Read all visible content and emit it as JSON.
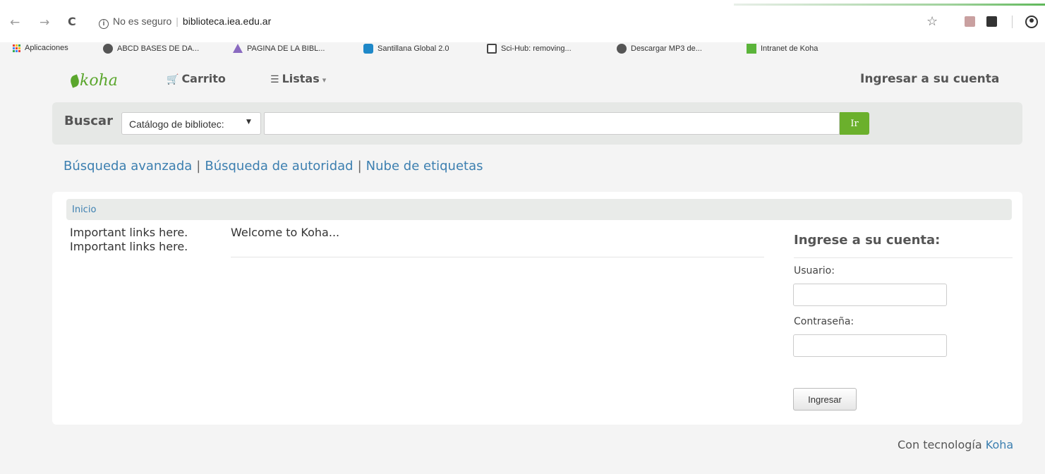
{
  "browser": {
    "security_label": "No es seguro",
    "url": "biblioteca.iea.edu.ar"
  },
  "bookmarks": [
    {
      "label": "Aplicaciones",
      "icon": "apps-grid-icon"
    },
    {
      "label": "ABCD BASES DE DA...",
      "icon": "globe-icon"
    },
    {
      "label": "PAGINA DE LA BIBL...",
      "icon": "warning-icon"
    },
    {
      "label": "Santillana Global 2.0",
      "icon": "santillana-icon"
    },
    {
      "label": "Sci-Hub: removing...",
      "icon": "scihub-icon"
    },
    {
      "label": "Descargar MP3 de...",
      "icon": "globe-icon"
    },
    {
      "label": "Intranet de Koha",
      "icon": "koha-icon"
    }
  ],
  "header": {
    "logo": "koha",
    "cart": "Carrito",
    "lists": "Listas",
    "login_link": "Ingresar a su cuenta"
  },
  "search": {
    "label": "Buscar",
    "selected_catalog": "Catálogo de bibliotec:",
    "query": "",
    "go_label": "Ir"
  },
  "more_links": {
    "advanced": "Búsqueda avanzada",
    "authority": "Búsqueda de autoridad",
    "tag_cloud": "Nube de etiquetas"
  },
  "breadcrumb": {
    "home": "Inicio"
  },
  "main": {
    "important_link_1": "Important links here.",
    "important_link_2": "Important links here.",
    "welcome": "Welcome to Koha..."
  },
  "login": {
    "title": "Ingrese a su cuenta:",
    "user_label": "Usuario:",
    "user_value": "",
    "password_label": "Contraseña:",
    "password_value": "",
    "submit_label": "Ingresar"
  },
  "footer": {
    "powered_by": "Con tecnología",
    "koha_link": "Koha"
  },
  "colors": {
    "accent_green": "#6bb02c",
    "link_blue": "#3c7fb0"
  }
}
